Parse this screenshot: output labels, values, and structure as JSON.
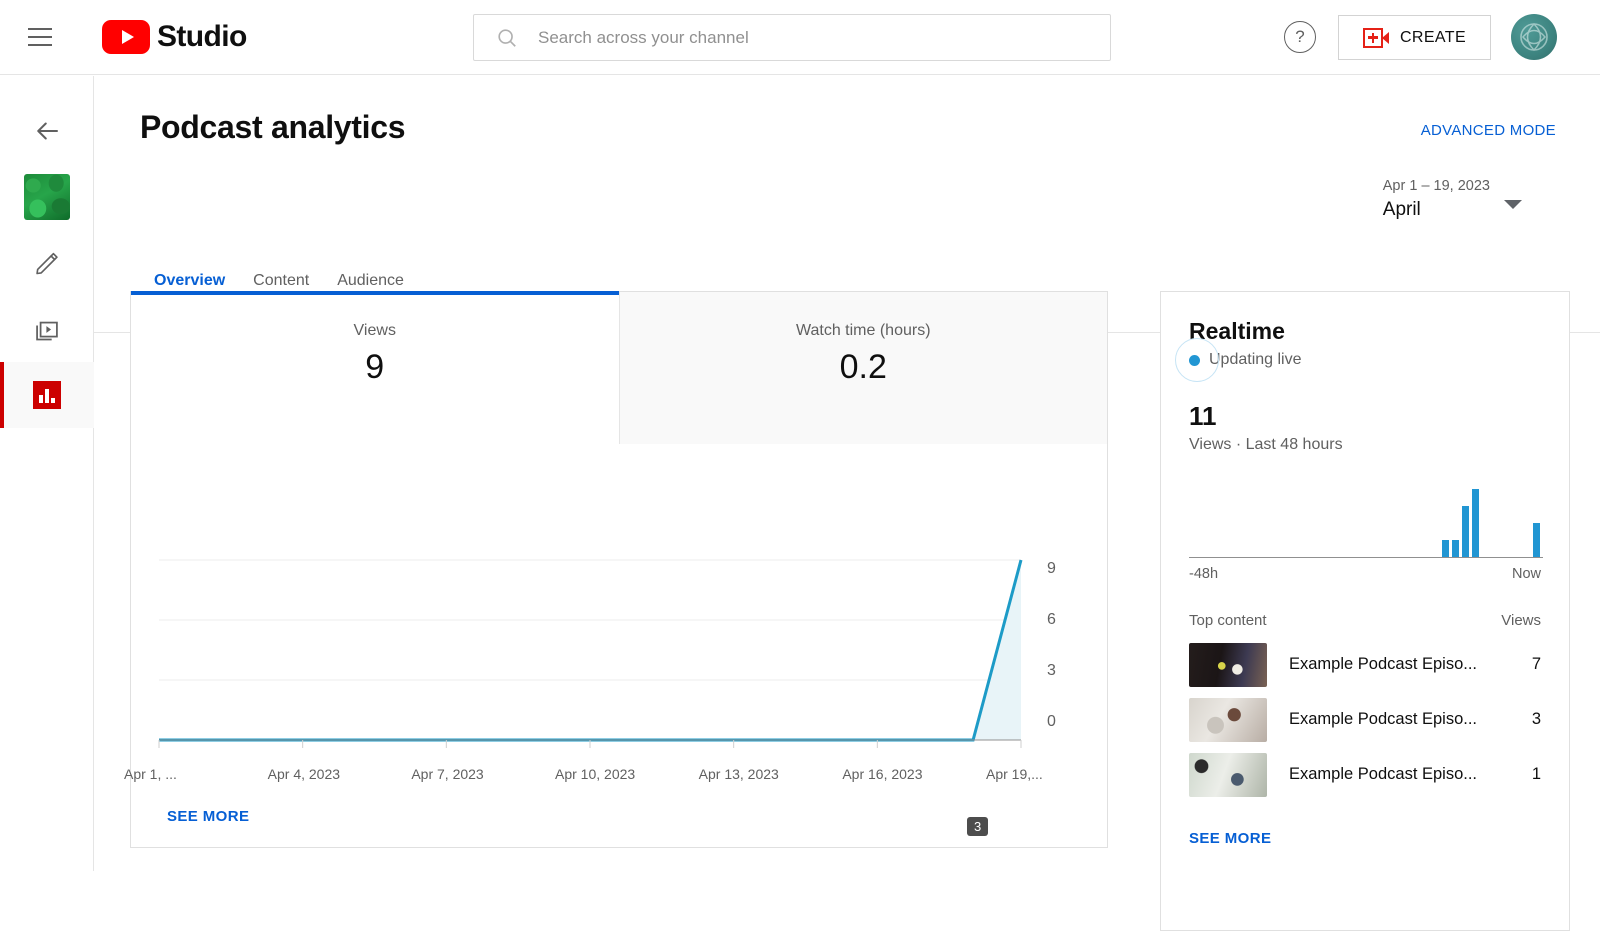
{
  "header": {
    "menu_icon": "hamburger-icon",
    "brand": "Studio",
    "search": {
      "placeholder": "Search across your channel",
      "value": "",
      "icon": "search-icon"
    },
    "help_label": "?",
    "create_label": "CREATE",
    "avatar_alt": "channel-avatar"
  },
  "sidebar": {
    "items": [
      {
        "name": "back",
        "icon": "arrow-left-icon",
        "label": ""
      },
      {
        "name": "channel-thumbnail",
        "icon": "channel-thumb",
        "label": ""
      },
      {
        "name": "edit",
        "icon": "pencil-icon",
        "label": ""
      },
      {
        "name": "content",
        "icon": "video-library-icon",
        "label": ""
      },
      {
        "name": "analytics",
        "icon": "analytics-bars-icon",
        "label": "",
        "active": true
      }
    ]
  },
  "page": {
    "title": "Podcast analytics",
    "advanced_mode": "ADVANCED MODE",
    "date_range_sub": "Apr 1 – 19, 2023",
    "date_range_main": "April",
    "tabs": [
      {
        "label": "Overview",
        "active": true
      },
      {
        "label": "Content",
        "active": false
      },
      {
        "label": "Audience",
        "active": false
      }
    ]
  },
  "metrics": [
    {
      "label": "Views",
      "value": "9",
      "active": true
    },
    {
      "label": "Watch time (hours)",
      "value": "0.2",
      "active": false
    }
  ],
  "chart_data": {
    "type": "line",
    "title": "Views",
    "xlabel": "",
    "ylabel": "Views",
    "ylim": [
      0,
      9
    ],
    "yticks": [
      "0",
      "3",
      "6",
      "9"
    ],
    "grid": true,
    "legend": "none",
    "xtick_labels": [
      "Apr 1, ...",
      "Apr 4, 2023",
      "Apr 7, 2023",
      "Apr 10, 2023",
      "Apr 13, 2023",
      "Apr 16, 2023",
      "Apr 19,..."
    ],
    "x": [
      "Apr 1",
      "Apr 2",
      "Apr 3",
      "Apr 4",
      "Apr 5",
      "Apr 6",
      "Apr 7",
      "Apr 8",
      "Apr 9",
      "Apr 10",
      "Apr 11",
      "Apr 12",
      "Apr 13",
      "Apr 14",
      "Apr 15",
      "Apr 16",
      "Apr 17",
      "Apr 18",
      "Apr 19"
    ],
    "values": [
      0,
      0,
      0,
      0,
      0,
      0,
      0,
      0,
      0,
      0,
      0,
      0,
      0,
      0,
      0,
      0,
      0,
      0,
      9
    ],
    "line_color": "#1d9bc7",
    "fill_color": "#e8f4f8",
    "point_badge": "3"
  },
  "chart_footer": {
    "see_more": "SEE MORE"
  },
  "realtime": {
    "title": "Realtime",
    "live_status": "Updating live",
    "count": "11",
    "subtitle": "Views · Last 48 hours",
    "sparkline": {
      "type": "bar",
      "values": [
        0,
        0,
        0,
        0,
        0,
        0,
        0,
        0,
        0,
        0,
        0,
        0,
        0,
        0,
        0,
        0,
        0,
        0,
        0,
        0,
        0,
        0,
        0,
        0,
        0,
        1,
        1,
        3,
        4,
        0,
        0,
        0,
        0,
        0,
        2
      ],
      "bar_color": "#2196d3"
    },
    "axis_left": "-48h",
    "axis_right": "Now",
    "top_content_header": "Top content",
    "views_header": "Views",
    "rows": [
      {
        "title": "Example Podcast Episo...",
        "views": "7",
        "thumb": "a"
      },
      {
        "title": "Example Podcast Episo...",
        "views": "3",
        "thumb": "b"
      },
      {
        "title": "Example Podcast Episo...",
        "views": "1",
        "thumb": "c"
      }
    ],
    "see_more": "SEE MORE"
  }
}
